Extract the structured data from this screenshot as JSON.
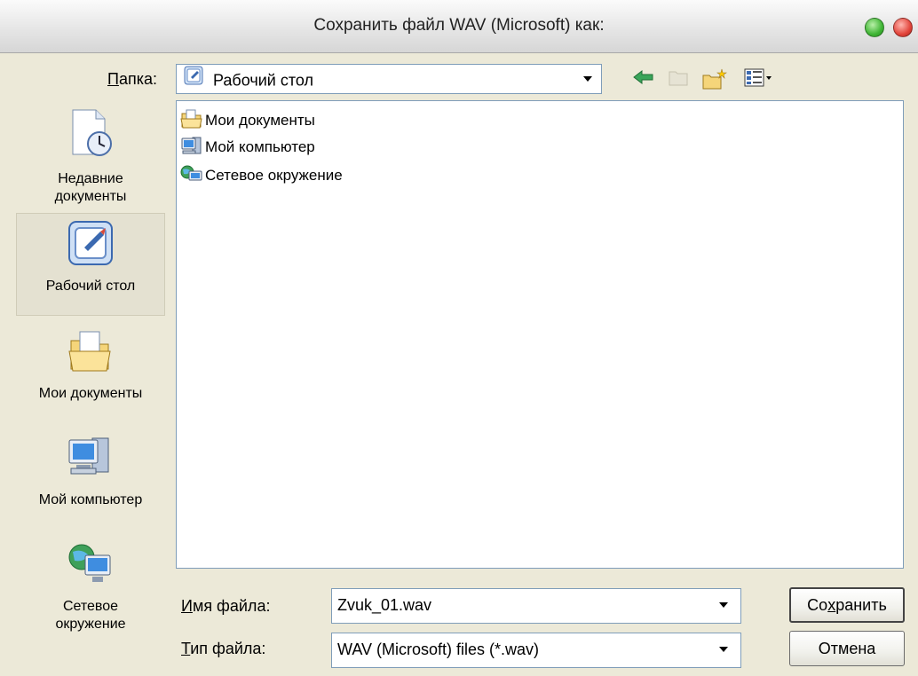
{
  "window": {
    "title": "Сохранить файл WAV (Microsoft) как:"
  },
  "folder": {
    "label_accel": "П",
    "label_rest": "апка:",
    "current": "Рабочий стол"
  },
  "places": [
    {
      "line1": "Недавние",
      "line2": "документы",
      "icon": "recent-documents-icon"
    },
    {
      "line1": "Рабочий стол",
      "line2": "",
      "icon": "desktop-icon"
    },
    {
      "line1": "Мои документы",
      "line2": "",
      "icon": "my-documents-icon"
    },
    {
      "line1": "Мой компьютер",
      "line2": "",
      "icon": "my-computer-icon"
    },
    {
      "line1": "Сетевое",
      "line2": "окружение",
      "icon": "network-icon"
    }
  ],
  "files": [
    {
      "label": "Мои документы",
      "icon": "my-documents-icon"
    },
    {
      "label": "Мой компьютер",
      "icon": "my-computer-icon"
    },
    {
      "label": "Сетевое окружение",
      "icon": "network-icon"
    }
  ],
  "filename": {
    "label_accel": "И",
    "label_rest": "мя файла:",
    "value": "Zvuk_01.wav"
  },
  "filetype": {
    "label_accel": "Т",
    "label_rest": "ип файла:",
    "value": "WAV (Microsoft) files (*.wav)"
  },
  "buttons": {
    "save_pre": "Со",
    "save_accel": "х",
    "save_post": "ранить",
    "cancel": "Отмена"
  },
  "colors": {
    "dialog_bg": "#ece9d8",
    "border": "#7f9db9",
    "close": "#e2443a",
    "zoom": "#3fb534"
  }
}
